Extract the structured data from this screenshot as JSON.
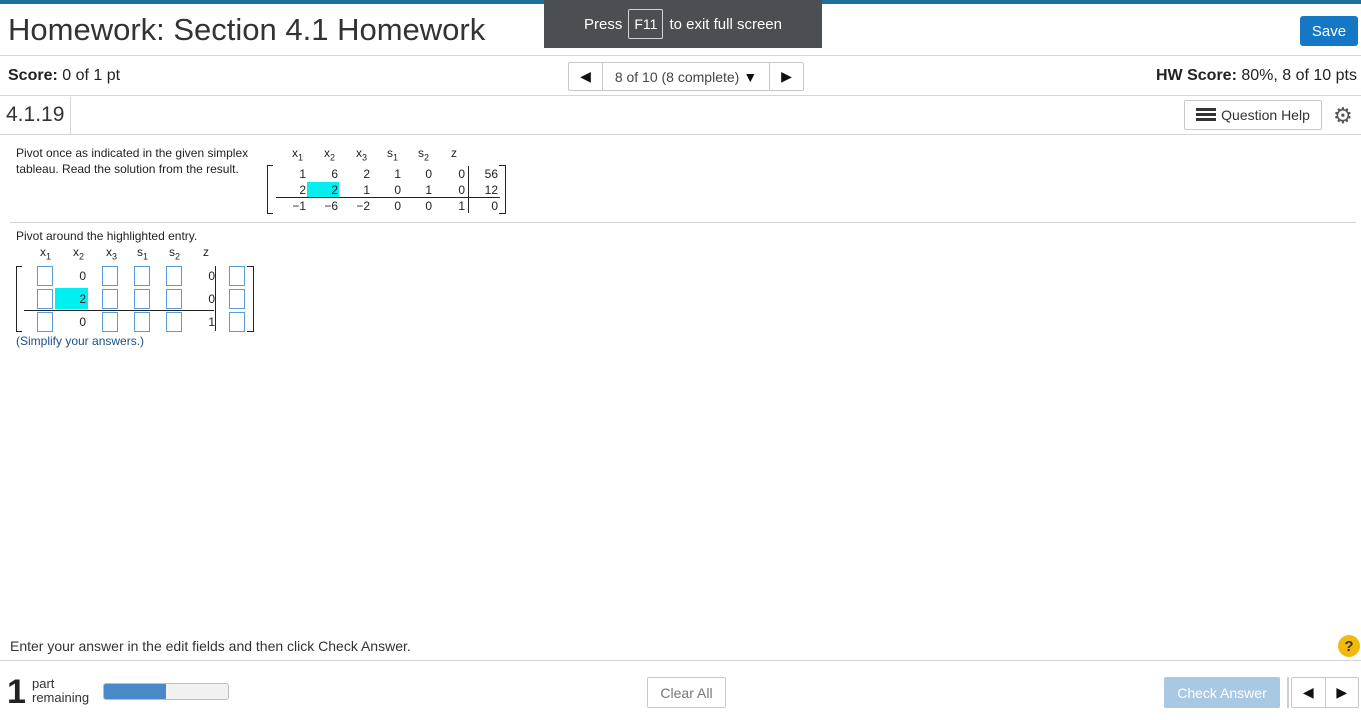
{
  "header": {
    "title": "Homework: Section 4.1 Homework",
    "save_label": "Save"
  },
  "fullscreen": {
    "press": "Press",
    "key": "F11",
    "message": "to exit full screen"
  },
  "scorebar": {
    "score_label": "Score:",
    "score_value": "0 of 1 pt",
    "nav_text": "8 of 10 (8 complete)",
    "hw_label": "HW Score:",
    "hw_value": "80%, 8 of 10 pts"
  },
  "question": {
    "number": "4.1.19",
    "help_label": "Question Help"
  },
  "problem": {
    "text": "Pivot once as indicated in the given simplex tableau. Read the solution from the result.",
    "headers": [
      "x",
      "x",
      "x",
      "s",
      "s",
      "z"
    ],
    "subscripts": [
      "1",
      "2",
      "3",
      "1",
      "2",
      ""
    ],
    "rows": [
      [
        "1",
        "6",
        "2",
        "1",
        "0",
        "0",
        "56"
      ],
      [
        "2",
        "2",
        "1",
        "0",
        "1",
        "0",
        "12"
      ],
      [
        "−1",
        "−6",
        "−2",
        "0",
        "0",
        "1",
        "0"
      ]
    ],
    "highlight": {
      "row": 2,
      "col": 2
    }
  },
  "answer": {
    "instruction": "Pivot around the highlighted entry.",
    "known": [
      {
        "row": 1,
        "col": 2,
        "value": "0"
      },
      {
        "row": 1,
        "col": 6,
        "value": "0"
      },
      {
        "row": 2,
        "col": 2,
        "value": "2"
      },
      {
        "row": 2,
        "col": 6,
        "value": "0"
      },
      {
        "row": 3,
        "col": 2,
        "value": "0"
      },
      {
        "row": 3,
        "col": 6,
        "value": "1"
      }
    ],
    "simplify_note": "(Simplify your answers.)"
  },
  "footer": {
    "hint": "Enter your answer in the edit fields and then click Check Answer.",
    "help_symbol": "?",
    "parts_count": "1",
    "parts_label_1": "part",
    "parts_label_2": "remaining",
    "progress": 0.5,
    "clear_label": "Clear All",
    "check_label": "Check Answer"
  },
  "colors": {
    "accent": "#1478c6",
    "highlight": "#00f0f0",
    "progress": "#4a89c8",
    "help": "#f2b90d"
  }
}
